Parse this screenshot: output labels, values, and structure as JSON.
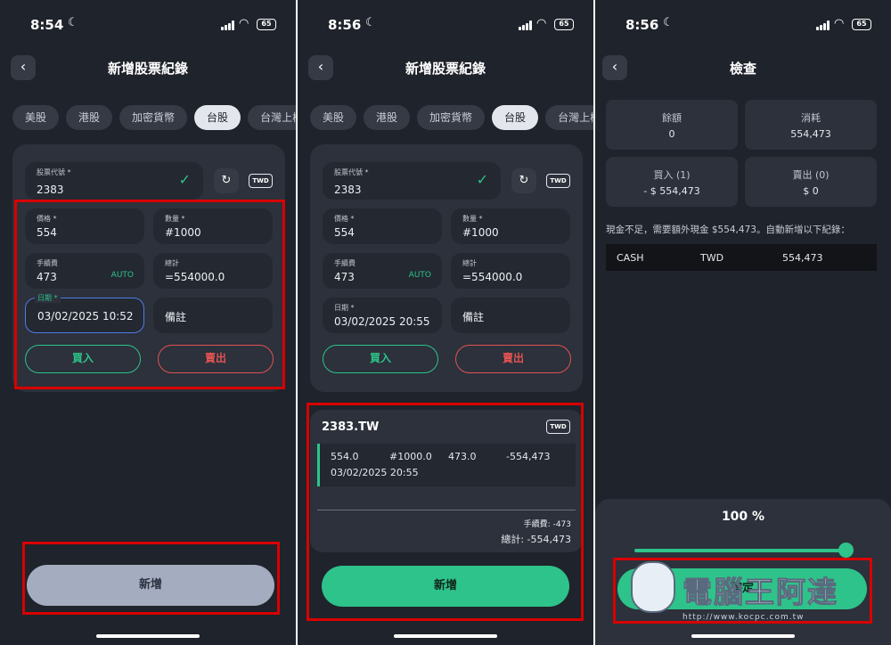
{
  "status": {
    "time_1": "8:54",
    "time_2": "8:56",
    "time_3": "8:56",
    "battery": "65"
  },
  "colors": {
    "accent": "#2ec38a",
    "sell": "#e25252",
    "highlight": "#d80000",
    "bg": "#1f232b",
    "card": "#2c313b"
  },
  "form": {
    "title": "新增股票紀錄",
    "tabs": [
      "美股",
      "港股",
      "加密貨幣",
      "台股",
      "台灣上櫃股"
    ],
    "code_label": "股票代號 *",
    "code_value": "2383",
    "currency": "TWD",
    "price_label": "價格 *",
    "price_value": "554",
    "qty_label": "數量 *",
    "qty_value": "#1000",
    "fee_label": "手續費",
    "fee_value": "473",
    "auto_label": "AUTO",
    "total_label": "總計",
    "total_value": "=554000.0",
    "date_label": "日期 *",
    "date_value_1": "03/02/2025 10:52",
    "date_value_2": "03/02/2025 20:55",
    "note_placeholder": "備註",
    "buy_label": "買入",
    "sell_label": "賣出",
    "add_label": "新增"
  },
  "result": {
    "symbol": "2383.TW",
    "currency": "TWD",
    "price": "554.0",
    "qty": "#1000.0",
    "fee": "473.0",
    "amount": "-554,473",
    "date": "03/02/2025 20:55",
    "fee_line": "手續費: -473",
    "total_line": "總計: -554,473"
  },
  "review": {
    "title": "檢查",
    "balance_label": "餘額",
    "balance_value": "0",
    "consume_label": "消耗",
    "consume_value": "554,473",
    "buy_label": "買入 (1)",
    "buy_value": "- $ 554,473",
    "sell_label": "賣出 (0)",
    "sell_value": "$ 0",
    "warning": "現金不足，需要額外現金 $554,473。自動新增以下紀錄：",
    "cash_type": "CASH",
    "cash_currency": "TWD",
    "cash_amount": "554,473",
    "percent": "100 %",
    "percent_value": 1.0,
    "confirm_label": "確定"
  },
  "watermark": {
    "text": "電腦王阿達",
    "url": "http://www.kocpc.com.tw"
  }
}
